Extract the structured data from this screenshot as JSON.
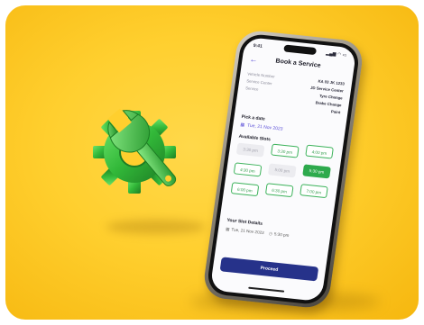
{
  "colors": {
    "background": "#ffcf2e",
    "wrench_green": "#32b839",
    "accent_blue": "#26328a",
    "slot_green": "#2eaa4d"
  },
  "phone": {
    "status": {
      "time": "9:41",
      "icons": "▂▄▆ ◠ ▭"
    },
    "header": {
      "back_icon": "arrow-left-icon",
      "title": "Book a Service"
    },
    "info": [
      {
        "label": "Vehicle Number",
        "value": "KA 03 JK 1233"
      },
      {
        "label": "Service Center",
        "value": "JD Service Center"
      },
      {
        "label": "Service",
        "value": "Tyre Change"
      },
      {
        "label": "",
        "value": "Brake Change"
      },
      {
        "label": "",
        "value": "Paint"
      }
    ],
    "pick_date": {
      "label": "Pick a date",
      "value": "Tue, 21 Nov 2023"
    },
    "slots_title": "Available Slots",
    "slots": [
      {
        "time": "3:30 pm",
        "state": "unavailable"
      },
      {
        "time": "3:30 pm",
        "state": "available"
      },
      {
        "time": "4:00 pm",
        "state": "available"
      },
      {
        "time": "4:30 pm",
        "state": "available"
      },
      {
        "time": "5:00 pm",
        "state": "unavailable"
      },
      {
        "time": "5:30 pm",
        "state": "selected"
      },
      {
        "time": "6:00 pm",
        "state": "available"
      },
      {
        "time": "6:30 pm",
        "state": "available"
      },
      {
        "time": "7:00 pm",
        "state": "available"
      }
    ],
    "slot_details": {
      "title": "Your Slot Details",
      "date": "Tue, 21 Nov 2023",
      "time": "5:30 pm"
    },
    "proceed_label": "Proceed"
  }
}
